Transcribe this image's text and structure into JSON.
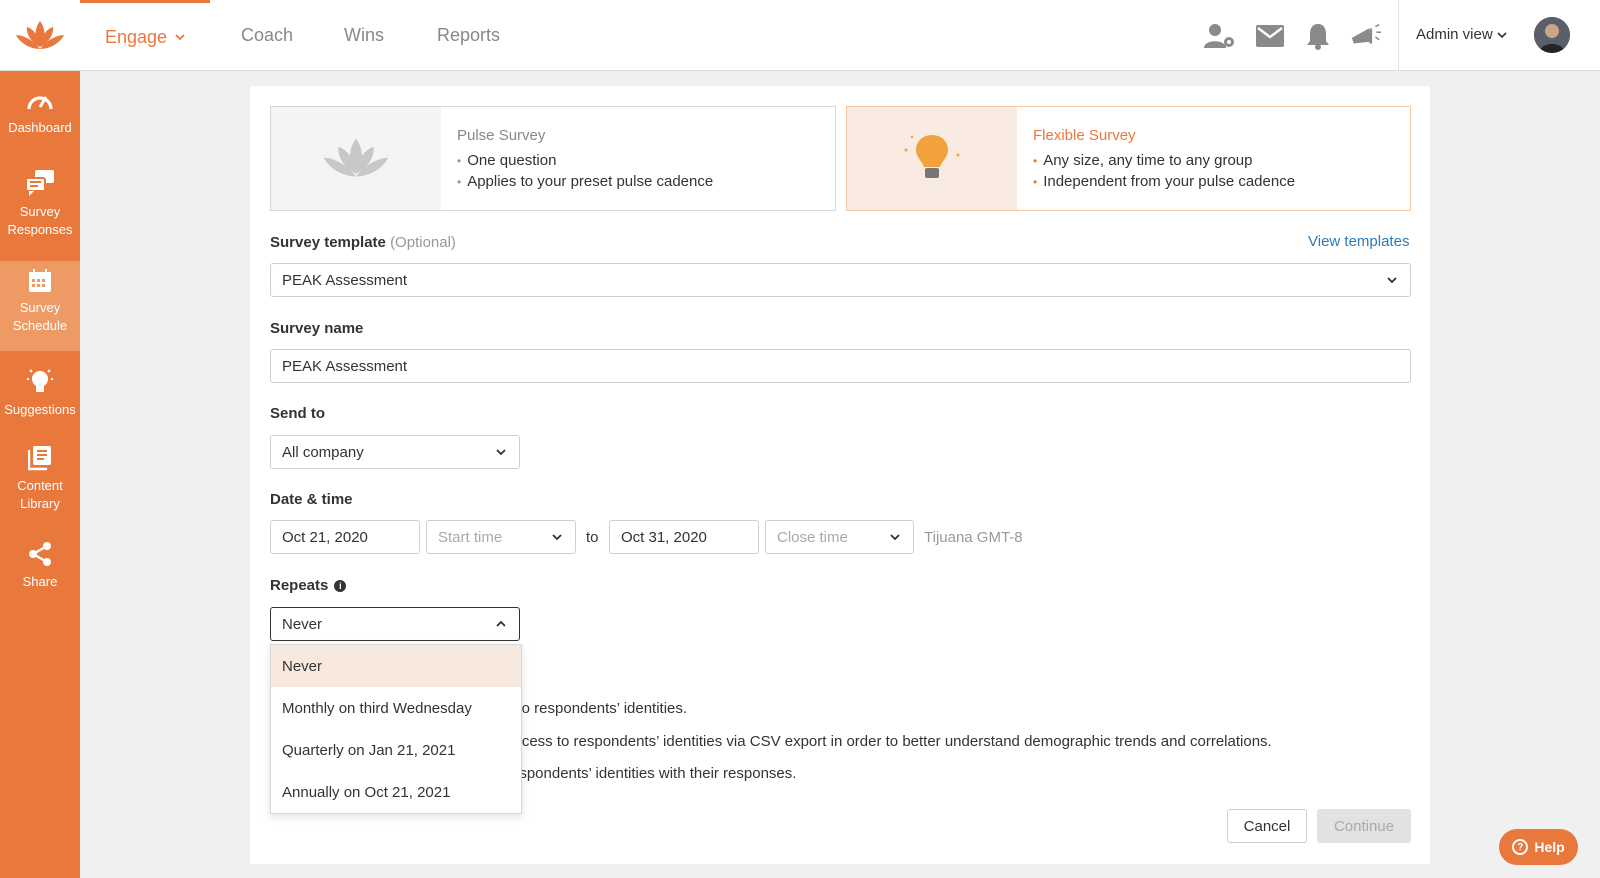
{
  "topnav": {
    "engage": "Engage",
    "coach": "Coach",
    "wins": "Wins",
    "reports": "Reports",
    "admin_view": "Admin view"
  },
  "sidebar": {
    "items": [
      {
        "label": "Dashboard",
        "icon": "gauge-icon"
      },
      {
        "label": "Survey Responses",
        "icon": "chat-icon"
      },
      {
        "label": "Survey Schedule",
        "icon": "calendar-icon"
      },
      {
        "label": "Suggestions",
        "icon": "lightbulb-icon"
      },
      {
        "label": "Content Library",
        "icon": "library-icon"
      },
      {
        "label": "Share",
        "icon": "share-icon"
      }
    ]
  },
  "survey_types": {
    "pulse": {
      "title": "Pulse Survey",
      "bullets": [
        "One question",
        "Applies to your preset pulse cadence"
      ]
    },
    "flexible": {
      "title": "Flexible Survey",
      "bullets": [
        "Any size, any time to any group",
        "Independent from your pulse cadence"
      ]
    }
  },
  "form": {
    "template_label": "Survey template",
    "template_optional": "(Optional)",
    "view_templates": "View templates",
    "template_value": "PEAK Assessment",
    "name_label": "Survey name",
    "name_value": "PEAK Assessment",
    "send_to_label": "Send to",
    "send_to_value": "All company",
    "datetime_label": "Date & time",
    "start_date": "Oct 21, 2020",
    "start_time_placeholder": "Start time",
    "to": "to",
    "end_date": "Oct 31, 2020",
    "close_time_placeholder": "Close time",
    "timezone": "Tijuana GMT-8",
    "repeats_label": "Repeats",
    "repeats_value": "Never",
    "repeat_options": [
      "Never",
      "Monthly on third Wednesday",
      "Quarterly on Jan 21, 2021",
      "Annually on Oct 21, 2021"
    ],
    "privacy_lines": [
      "ess to respondents’ identities.",
      "access to respondents’ identities via CSV export in order to better understand demographic trends and correlations.",
      "respondents’ identities with their responses."
    ]
  },
  "buttons": {
    "cancel": "Cancel",
    "continue": "Continue",
    "help": "Help"
  },
  "colors": {
    "accent": "#e8783c",
    "link": "#2b7bb9"
  }
}
